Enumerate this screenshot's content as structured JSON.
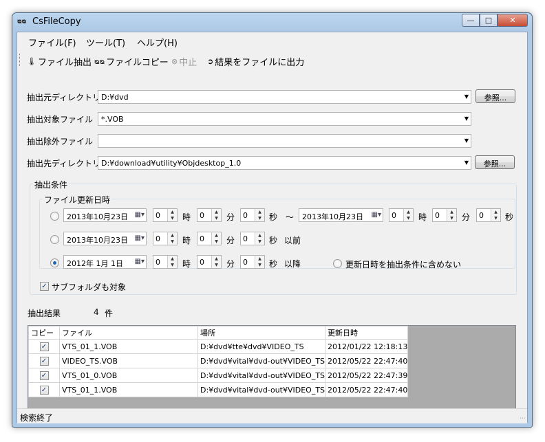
{
  "window": {
    "title": "CsFileCopy",
    "app_icon": "ᴓᴓ"
  },
  "menu": [
    "ファイル(F)",
    "ツール(T)",
    "ヘルプ(H)"
  ],
  "toolbar": {
    "extract": "ファイル抽出",
    "copy": "ファイルコピー",
    "stop": "中止",
    "export": "結果をファイルに出力"
  },
  "form": {
    "src_dir_label": "抽出元ディレクトリ",
    "src_dir_value": "D:¥dvd",
    "target_label": "抽出対象ファイル",
    "target_value": "*.VOB",
    "exclude_label": "抽出除外ファイル",
    "exclude_value": "",
    "dest_dir_label": "抽出先ディレクトリ",
    "dest_dir_value": "D:¥download¥utility¥Objdesktop_1.0",
    "browse_label": "参照..."
  },
  "conditions": {
    "group_title": "抽出条件",
    "date_group_title": "ファイル更新日時",
    "hour": "時",
    "minute": "分",
    "second": "秒",
    "range": {
      "from_date": "2013年10月23日",
      "from_h": "0",
      "from_m": "0",
      "from_s": "0",
      "tilde": "～",
      "to_date": "2013年10月23日",
      "to_h": "0",
      "to_m": "0",
      "to_s": "0"
    },
    "before": {
      "date": "2013年10月23日",
      "h": "0",
      "m": "0",
      "s": "0",
      "suffix": "以前"
    },
    "after": {
      "date": "2012年  1月  1日",
      "h": "0",
      "m": "0",
      "s": "0",
      "suffix": "以降"
    },
    "no_date_label": "更新日時を抽出条件に含めない",
    "subfolder_label": "サブフォルダも対象"
  },
  "results": {
    "label": "抽出結果",
    "count": "4",
    "count_unit": "件",
    "columns": [
      "コピー",
      "ファイル",
      "場所",
      "更新日時"
    ],
    "rows": [
      {
        "file": "VTS_01_1.VOB",
        "location": "D:¥dvd¥tte¥dvd¥VIDEO_TS",
        "modified": "2012/01/22 12:18:13"
      },
      {
        "file": "VIDEO_TS.VOB",
        "location": "D:¥dvd¥vital¥dvd-out¥VIDEO_TS",
        "modified": "2012/05/22 22:47:40"
      },
      {
        "file": "VTS_01_0.VOB",
        "location": "D:¥dvd¥vital¥dvd-out¥VIDEO_TS",
        "modified": "2012/05/22 22:47:39"
      },
      {
        "file": "VTS_01_1.VOB",
        "location": "D:¥dvd¥vital¥dvd-out¥VIDEO_TS",
        "modified": "2012/05/22 22:47:40"
      }
    ]
  },
  "status": {
    "text": "検索終了"
  },
  "colors": {
    "title_bar": "#aec9e6",
    "client_bg": "#f0f0f0",
    "grid_bg": "#ababab",
    "radio_accent": "#1c64b4"
  }
}
